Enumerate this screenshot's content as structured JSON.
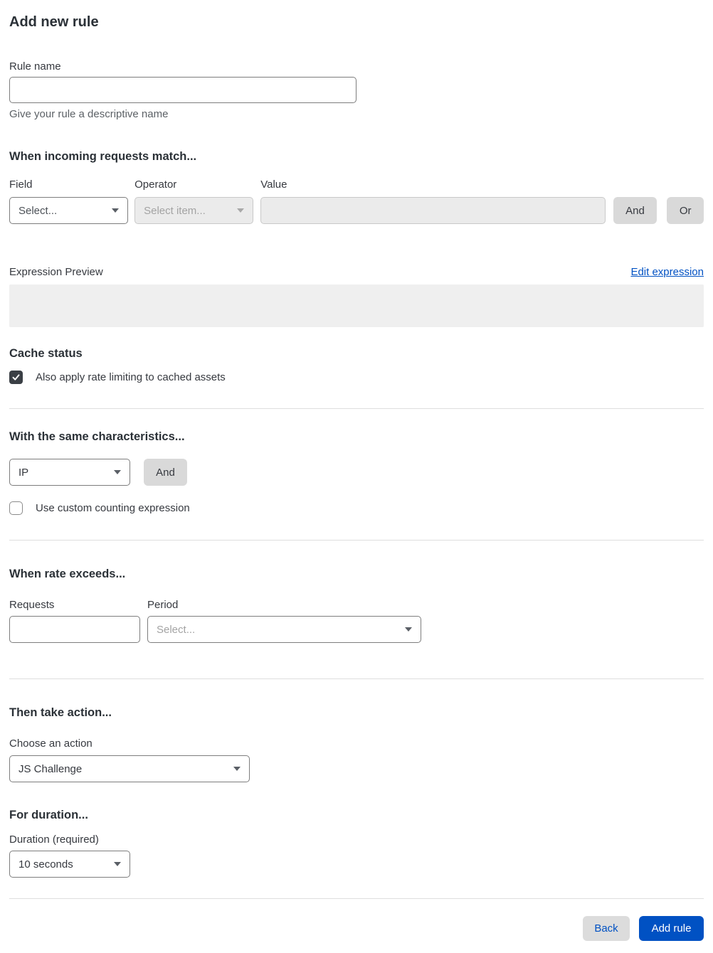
{
  "page": {
    "title": "Add new rule"
  },
  "rule_name": {
    "label": "Rule name",
    "value": "",
    "helper": "Give your rule a descriptive name"
  },
  "match": {
    "heading": "When incoming requests match...",
    "field": {
      "label": "Field",
      "placeholder": "Select..."
    },
    "operator": {
      "label": "Operator",
      "placeholder": "Select item..."
    },
    "value": {
      "label": "Value",
      "value": ""
    },
    "and_label": "And",
    "or_label": "Or"
  },
  "expression": {
    "label": "Expression Preview",
    "edit_link": "Edit expression",
    "value": ""
  },
  "cache": {
    "heading": "Cache status",
    "checkbox_label": "Also apply rate limiting to cached assets",
    "checked": true
  },
  "characteristics": {
    "heading": "With the same characteristics...",
    "selected": "IP",
    "and_label": "And",
    "custom_expression_label": "Use custom counting expression",
    "custom_expression_checked": false
  },
  "rate": {
    "heading": "When rate exceeds...",
    "requests_label": "Requests",
    "requests_value": "",
    "period_label": "Period",
    "period_placeholder": "Select..."
  },
  "action": {
    "heading": "Then take action...",
    "label": "Choose an action",
    "selected": "JS Challenge"
  },
  "duration": {
    "heading": "For duration...",
    "label": "Duration (required)",
    "selected": "10 seconds"
  },
  "footer": {
    "back_label": "Back",
    "add_label": "Add rule"
  },
  "colors": {
    "accent_blue": "#0051c3",
    "disabled_bg": "#ebebeb",
    "button_gray": "#d9d9d9",
    "checkbox_dark": "#3a3f45"
  }
}
